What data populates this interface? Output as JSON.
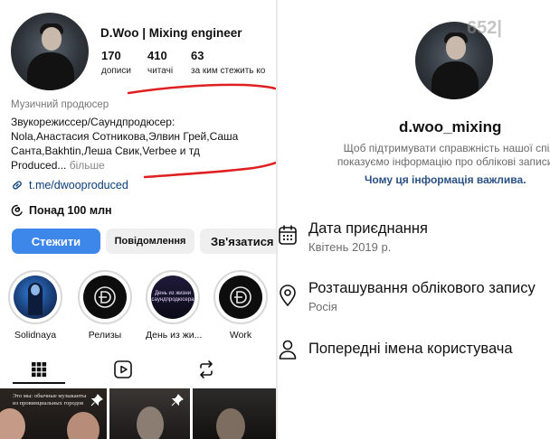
{
  "left": {
    "profile": {
      "title": "D.Woo | Mixing engineer",
      "stats": [
        {
          "value": "170",
          "label": "дописи"
        },
        {
          "value": "410",
          "label": "читачі"
        },
        {
          "value": "63",
          "label": "за ким стежить ко"
        }
      ],
      "category": "Музичний продюсер",
      "bio_lines": [
        "Звукорежиссер/Саундпродюсер:",
        "Nola,Анастасия Сотникова,Элвин Грей,Саша",
        "Санта,Bakhtin,Леша Свик,Verbee и тд",
        "Produced..."
      ],
      "more": " більше",
      "link": "t.me/dwooproduced",
      "threads": "Понад 100 млн"
    },
    "buttons": {
      "follow": "Стежити",
      "message": "Повідомлення",
      "contact": "Зв'язатися"
    },
    "highlights": [
      {
        "label": "Solidnaya",
        "icon": "photo"
      },
      {
        "label": "Релизы",
        "icon": "d-logo"
      },
      {
        "label": "День из жи...",
        "icon": "text-cover",
        "cover_text": [
          "День из жизни",
          "саундпродюсера"
        ]
      },
      {
        "label": "Work",
        "icon": "d-logo"
      }
    ],
    "tabs": [
      "grid-icon",
      "reels-icon",
      "reposts-icon"
    ],
    "posts": [
      {
        "overlay": [
          "Это мы: обычные музыканты",
          "из провинциальных городов"
        ],
        "pinned": true
      },
      {
        "overlay": [],
        "pinned": true
      },
      {
        "overlay": [],
        "pinned": false
      }
    ],
    "colors": {
      "accent": "#3d86ea",
      "annotation": "#e02020"
    }
  },
  "right": {
    "watermark": "652|",
    "handle": "d.woo_mixing",
    "notice_lines": [
      "Щоб підтримувати справжність нашої спіл",
      "показуємо інформацію про облікові записи в"
    ],
    "why_link": "Чому ця інформація важлива.",
    "rows": [
      {
        "icon": "calendar-icon",
        "title": "Дата приєднання",
        "sub": "Квітень 2019 р."
      },
      {
        "icon": "location-icon",
        "title": "Розташування облікового запису",
        "sub": "Росія"
      },
      {
        "icon": "person-icon",
        "title": "Попередні імена користувача",
        "sub": ""
      }
    ]
  }
}
